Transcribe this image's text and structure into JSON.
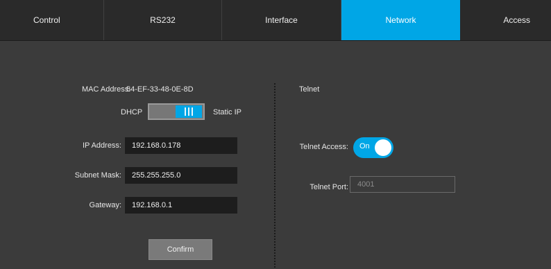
{
  "tabs": [
    {
      "label": "Control"
    },
    {
      "label": "RS232"
    },
    {
      "label": "Interface"
    },
    {
      "label": "Network",
      "active": true
    },
    {
      "label": "Access"
    }
  ],
  "network": {
    "mac_label": "MAC Address:",
    "mac_value": "54-EF-33-48-0E-8D",
    "mode_left": "DHCP",
    "mode_right": "Static IP",
    "mode_selected": "Static IP",
    "ip_label": "IP Address:",
    "ip_value": "192.168.0.178",
    "subnet_label": "Subnet Mask:",
    "subnet_value": "255.255.255.0",
    "gateway_label": "Gateway:",
    "gateway_value": "192.168.0.1",
    "confirm_label": "Confirm"
  },
  "telnet": {
    "title": "Telnet",
    "access_label": "Telnet Access:",
    "access_state": "On",
    "port_label": "Telnet Port:",
    "port_placeholder": "4001"
  },
  "colors": {
    "accent": "#00a6e6",
    "background": "#3b3b3b",
    "tab_bar": "#2a2a2a",
    "field": "#1d1d1d"
  }
}
